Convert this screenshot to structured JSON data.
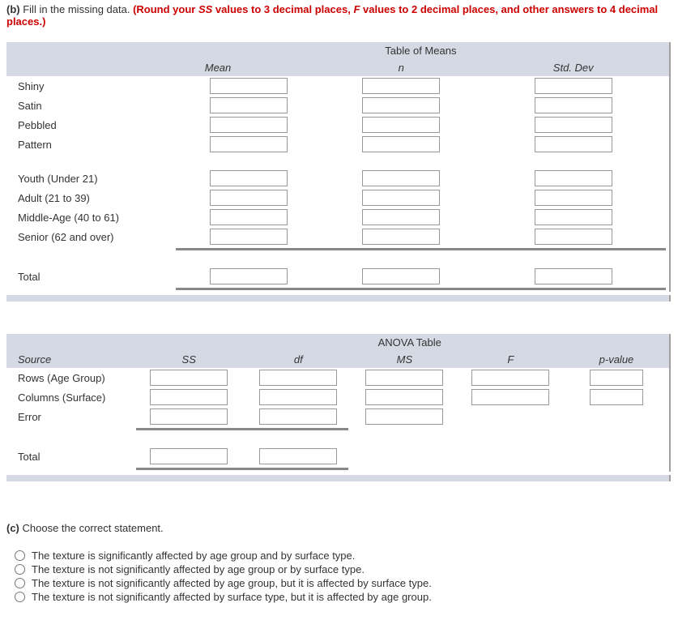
{
  "partB": {
    "label": "(b)",
    "text": " Fill in the missing data. ",
    "note_prefix": "(Round your ",
    "ss": "SS",
    "note_mid1": " values to 3 decimal places, ",
    "f": "F",
    "note_mid2": " values to 2 decimal places, and other answers to 4 decimal places.)"
  },
  "means": {
    "title": "Table of Means",
    "cols": {
      "mean": "Mean",
      "n": "n",
      "sd": "Std. Dev"
    },
    "group1": [
      "Shiny",
      "Satin",
      "Pebbled",
      "Pattern"
    ],
    "group2": [
      "Youth (Under 21)",
      "Adult (21 to 39)",
      "Middle-Age (40 to 61)",
      "Senior (62 and over)"
    ],
    "total": "Total"
  },
  "anova": {
    "title": "ANOVA Table",
    "cols": {
      "source": "Source",
      "ss": "SS",
      "df": "df",
      "ms": "MS",
      "f": "F",
      "p": "p-value"
    },
    "rows": [
      "Rows (Age Group)",
      "Columns (Surface)",
      "Error"
    ],
    "total": "Total"
  },
  "partC": {
    "label": "(c)",
    "text": " Choose the correct statement.",
    "options": [
      "The texture is significantly affected by age group and by surface type.",
      "The texture is not significantly affected by age group or by surface type.",
      "The texture is not significantly affected by age group, but it is affected by surface type.",
      "The texture is not significantly affected by surface type, but it is affected by age group."
    ]
  }
}
